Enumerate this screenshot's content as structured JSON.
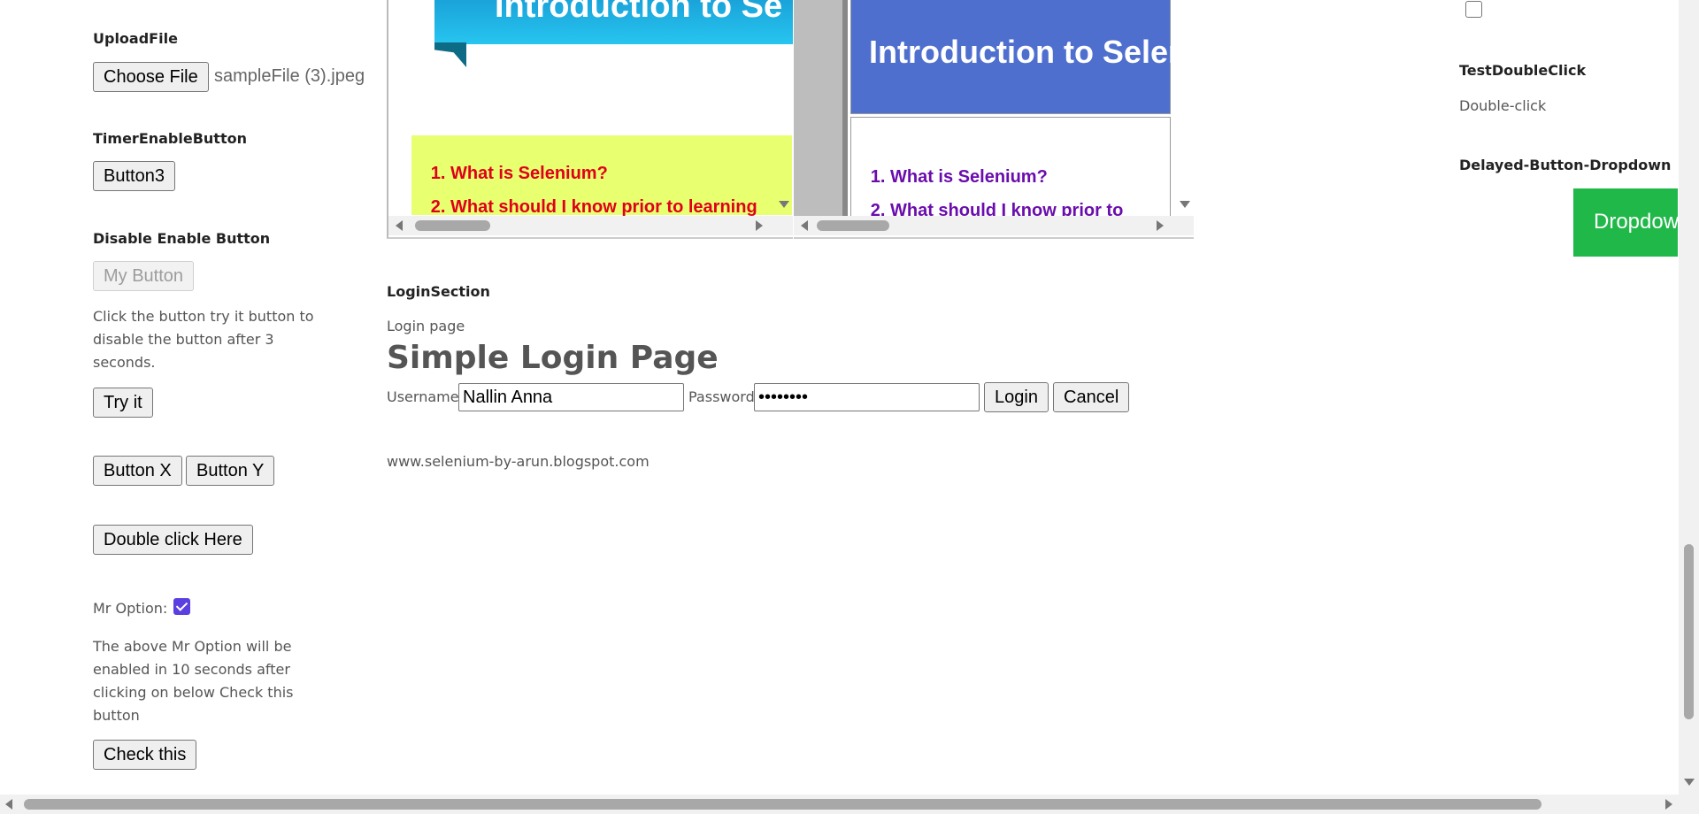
{
  "upload": {
    "heading": "UploadFile",
    "choose_label": "Choose File",
    "file_name": "sampleFile (3).jpeg"
  },
  "timer": {
    "heading": "TimerEnableButton",
    "button_label": "Button3"
  },
  "disable_enable": {
    "heading": "Disable Enable Button",
    "button_label": "My Button",
    "description": "Click the button try it button to disable the button after 3 seconds.",
    "try_label": "Try it"
  },
  "xy": {
    "x_label": "Button X",
    "y_label": "Button Y"
  },
  "double_click_button": "Double click Here",
  "mr_option": {
    "label": "Mr Option:",
    "checked": true,
    "description": "The above Mr Option will be enabled in 10 seconds after clicking on below Check this button",
    "check_label": "Check this"
  },
  "frame_left": {
    "banner_text": "Introduction to Se",
    "items": [
      "What is Selenium?",
      "What should I know prior to learning"
    ],
    "item_color": "#e0001a",
    "box_color": "#e8ff70"
  },
  "frame_right": {
    "banner_text": "Introduction to Selen",
    "items": [
      "What is Selenium?",
      "What should I know prior to"
    ],
    "item_color": "#6a0dad",
    "banner_color": "#4f6fcf"
  },
  "login": {
    "section_heading": "LoginSection",
    "subtitle": "Login page",
    "title": "Simple Login Page",
    "username_label": "Username",
    "username_value": "Nallin Anna",
    "password_label": "Password",
    "password_value": "••••••••",
    "login_label": "Login",
    "cancel_label": "Cancel",
    "site": "www.selenium-by-arun.blogspot.com"
  },
  "right_col": {
    "double_click_heading": "TestDoubleClick",
    "double_click_text": "Double-click",
    "dropdown_heading": "Delayed-Button-Dropdown",
    "dropdown_label": "Dropdow",
    "dropdown_color": "#21b84a"
  }
}
